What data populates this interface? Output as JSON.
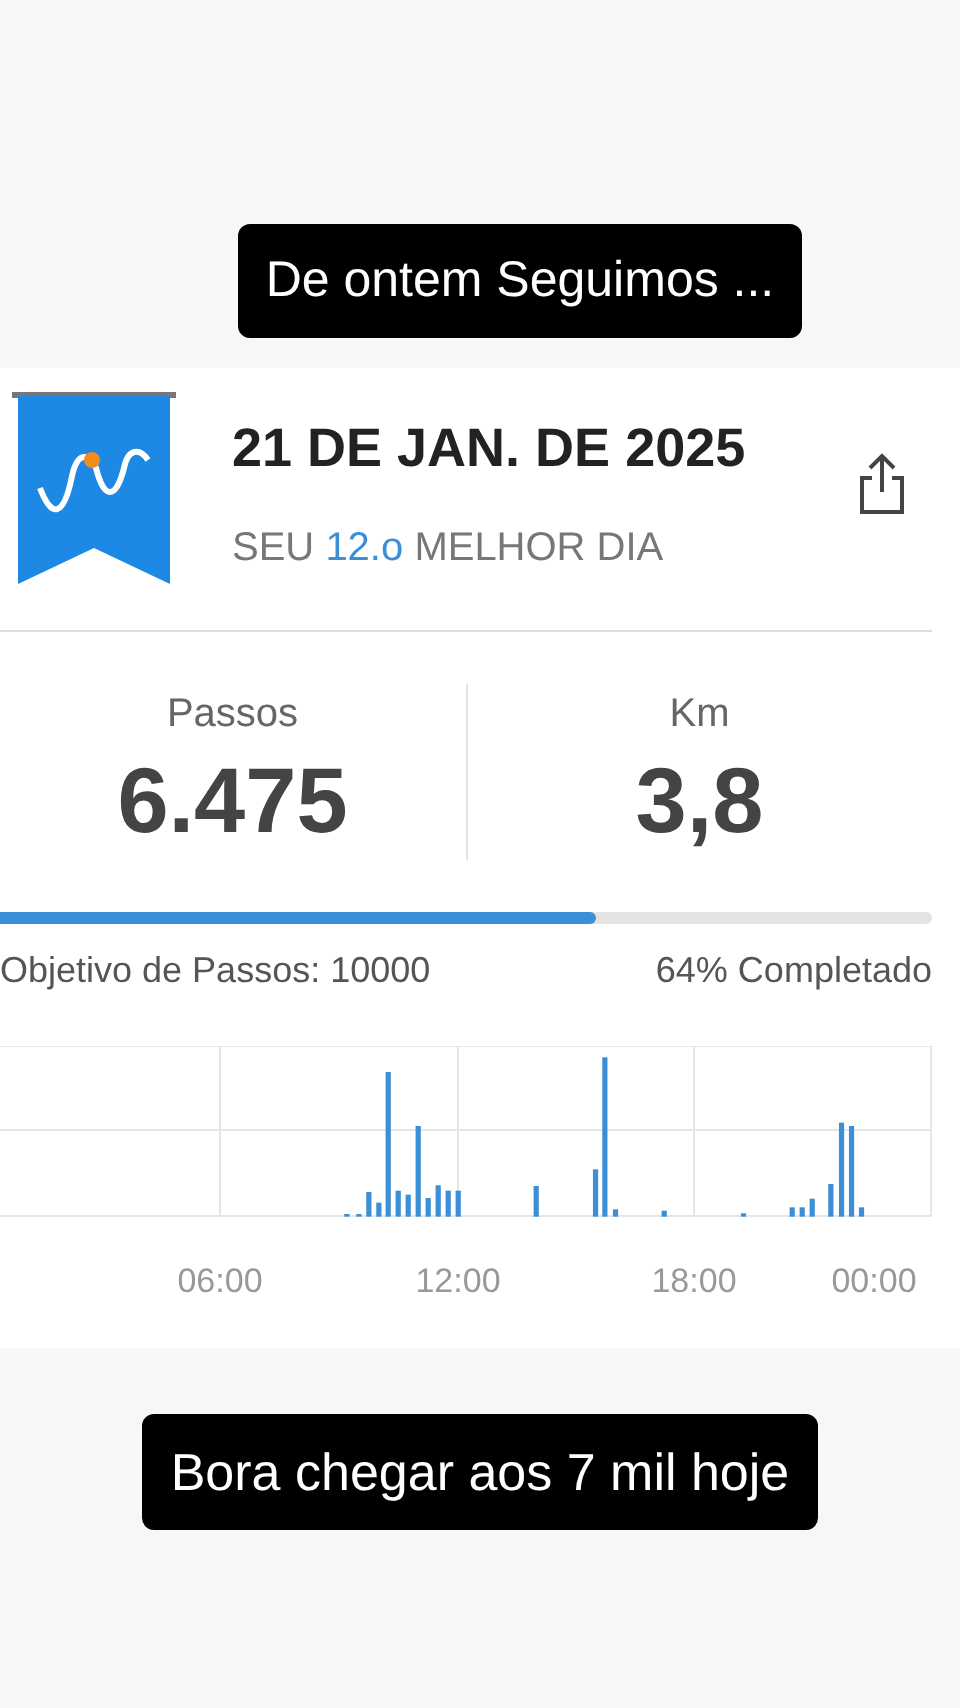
{
  "top_caption": "De ontem Seguimos ...",
  "header": {
    "date": "21 DE JAN. DE 2025",
    "subtitle_before": "SEU",
    "rank": "12.o",
    "subtitle_after": "MELHOR DIA"
  },
  "stats": [
    {
      "label": "Passos",
      "value": "6.475"
    },
    {
      "label": "Km",
      "value": "3,8"
    }
  ],
  "goal": {
    "level": 0.64,
    "label": "Objetivo de Passos: 10000",
    "completed": "64% Completado"
  },
  "chart": {
    "x_labels": [
      "06:00",
      "12:00",
      "18:00",
      "00:00"
    ]
  },
  "bottom_caption": "Bora chegar aos 7 mil hoje"
}
